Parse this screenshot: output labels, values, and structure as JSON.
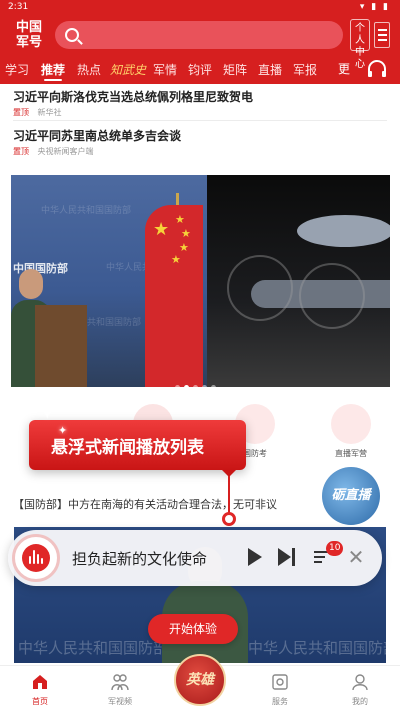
{
  "status_bar": {
    "time": "2:31",
    "icons": "▾ ▮ ▮"
  },
  "app": {
    "logo": "中国\n军号",
    "profile_label": "个人\n中心"
  },
  "colors": {
    "brand_red": "#d61f1f",
    "accent_gold": "#ffd36b"
  },
  "tabs": [
    {
      "label": "学习"
    },
    {
      "label": "推荐",
      "active": true
    },
    {
      "label": "热点"
    },
    {
      "label": "知武史"
    },
    {
      "label": "军情"
    },
    {
      "label": "钧评"
    },
    {
      "label": "矩阵"
    },
    {
      "label": "直播"
    },
    {
      "label": "军报"
    }
  ],
  "tabs_more": "更",
  "news": [
    {
      "title": "习近平向斯洛伐克当选总统佩列格里尼致贺电",
      "tag": "置顶",
      "source": "新华社"
    },
    {
      "title": "习近平同苏里南总统单多吉会谈",
      "tag": "置顶",
      "source": "央视新闻客户端"
    }
  ],
  "banner": {
    "mod_logo": "中国国防部",
    "watermark": "中华人民共和国国防部",
    "page_count": 5,
    "active_page": 1
  },
  "quick_links": [
    {
      "label": ""
    },
    {
      "label": "国防考"
    },
    {
      "label": "直播军营"
    }
  ],
  "popup": {
    "text": "悬浮式新闻播放列表"
  },
  "news3": {
    "title": "【国防部】中方在南海的有关活动合理合法，无可非议"
  },
  "live_badge": "砺直播",
  "video": {
    "watermark": "中华人民共和国国防部"
  },
  "player": {
    "title": "担负起新的文化使命",
    "playlist_count": "10"
  },
  "start_button": "开始体验",
  "hero_button": "英雄",
  "bottom_nav": [
    {
      "label": "首页",
      "active": true
    },
    {
      "label": "军视频"
    },
    {
      "label": "服务"
    },
    {
      "label": "我的"
    }
  ]
}
